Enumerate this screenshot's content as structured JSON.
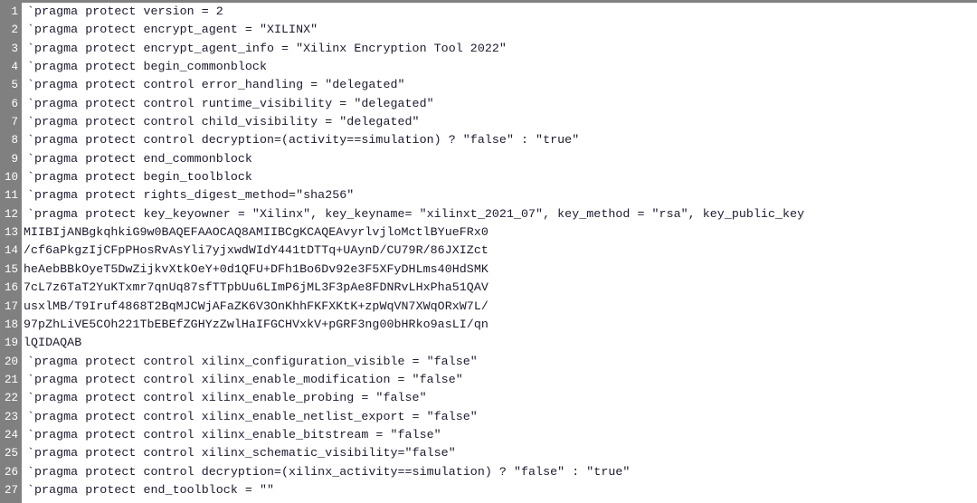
{
  "editor": {
    "kind": "source-code-viewer",
    "language": "verilog",
    "colors": {
      "background": "#ffffff",
      "gutter_background": "#808080",
      "gutter_text": "#ffffff",
      "code_text": "#1a1a2e",
      "top_rule": "#808080"
    },
    "first_visible_line": 1,
    "last_visible_line": 27,
    "total_visible_lines": 27
  },
  "lines": [
    {
      "number": "1",
      "text": "`pragma protect version = 2",
      "style": "code"
    },
    {
      "number": "2",
      "text": "`pragma protect encrypt_agent = \"XILINX\"",
      "style": "code"
    },
    {
      "number": "3",
      "text": "`pragma protect encrypt_agent_info = \"Xilinx Encryption Tool 2022\"",
      "style": "code"
    },
    {
      "number": "4",
      "text": "`pragma protect begin_commonblock",
      "style": "code"
    },
    {
      "number": "5",
      "text": "`pragma protect control error_handling = \"delegated\"",
      "style": "code"
    },
    {
      "number": "6",
      "text": "`pragma protect control runtime_visibility = \"delegated\"",
      "style": "code"
    },
    {
      "number": "7",
      "text": "`pragma protect control child_visibility = \"delegated\"",
      "style": "code"
    },
    {
      "number": "8",
      "text": "`pragma protect control decryption=(activity==simulation) ? \"false\" : \"true\"",
      "style": "code"
    },
    {
      "number": "9",
      "text": "`pragma protect end_commonblock",
      "style": "code"
    },
    {
      "number": "10",
      "text": "`pragma protect begin_toolblock",
      "style": "code"
    },
    {
      "number": "11",
      "text": "`pragma protect rights_digest_method=\"sha256\"",
      "style": "code"
    },
    {
      "number": "12",
      "text": "`pragma protect key_keyowner = \"Xilinx\", key_keyname= \"xilinxt_2021_07\", key_method = \"rsa\", key_public_key",
      "style": "code"
    },
    {
      "number": "13",
      "text": "MIIBIjANBgkqhkiG9w0BAQEFAAOCAQ8AMIIBCgKCAQEAvyrlvjloMctlBYueFRx0",
      "style": "base64"
    },
    {
      "number": "14",
      "text": "/cf6aPkgzIjCFpPHosRvAsYli7yjxwdWIdY441tDTTq+UAynD/CU79R/86JXIZct",
      "style": "base64"
    },
    {
      "number": "15",
      "text": "heAebBBkOyeT5DwZijkvXtkOeY+0d1QFU+DFh1Bo6Dv92e3F5XFyDHLms40HdSMK",
      "style": "base64"
    },
    {
      "number": "16",
      "text": "7cL7z6TaT2YuKTxmr7qnUq87sfTTpbUu6LImP6jML3F3pAe8FDNRvLHxPha51QAV",
      "style": "base64"
    },
    {
      "number": "17",
      "text": "usxlMB/T9Iruf4868T2BqMJCWjAFaZK6V3OnKhhFKFXKtK+zpWqVN7XWqORxW7L/",
      "style": "base64"
    },
    {
      "number": "18",
      "text": "97pZhLiVE5COh221TbEBEfZGHYzZwlHaIFGCHVxkV+pGRF3ng00bHRko9asLI/qn",
      "style": "base64"
    },
    {
      "number": "19",
      "text": "lQIDAQAB",
      "style": "base64"
    },
    {
      "number": "20",
      "text": "`pragma protect control xilinx_configuration_visible = \"false\"",
      "style": "code"
    },
    {
      "number": "21",
      "text": "`pragma protect control xilinx_enable_modification = \"false\"",
      "style": "code"
    },
    {
      "number": "22",
      "text": "`pragma protect control xilinx_enable_probing = \"false\"",
      "style": "code"
    },
    {
      "number": "23",
      "text": "`pragma protect control xilinx_enable_netlist_export = \"false\"",
      "style": "code"
    },
    {
      "number": "24",
      "text": "`pragma protect control xilinx_enable_bitstream = \"false\"",
      "style": "code"
    },
    {
      "number": "25",
      "text": "`pragma protect control xilinx_schematic_visibility=\"false\"",
      "style": "code"
    },
    {
      "number": "26",
      "text": "`pragma protect control decryption=(xilinx_activity==simulation) ? \"false\" : \"true\"",
      "style": "code"
    },
    {
      "number": "27",
      "text": "`pragma protect end_toolblock = \"\"",
      "style": "code"
    }
  ]
}
